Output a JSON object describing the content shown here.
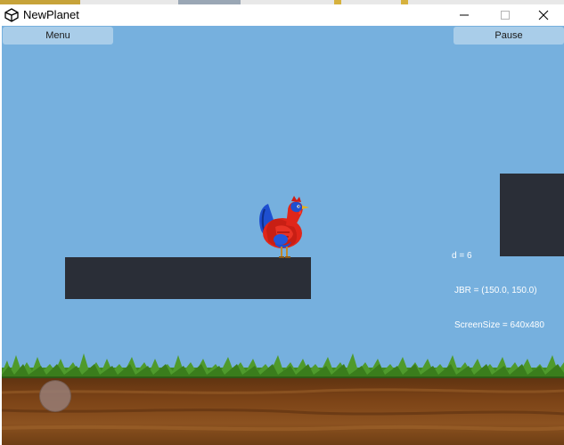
{
  "window": {
    "title": "NewPlanet",
    "app_icon": "unity-icon",
    "controls": [
      "minimize-icon",
      "maximize-icon",
      "close-icon"
    ]
  },
  "hud": {
    "menu_label": "Menu",
    "pause_label": "Pause"
  },
  "debug": {
    "line1": "d = 6",
    "line2": "JBR = (150.0, 150.0)",
    "line3": "ScreenSize = 640x480"
  },
  "colors": {
    "sky": "#76b0de",
    "platform": "#2a2e37",
    "button": "#a9cde9",
    "grass": "#4f9a2c",
    "dirt": "#6b3a12"
  },
  "sprites": {
    "player": "chicken-sprite",
    "joystick": "virtual-joystick"
  }
}
